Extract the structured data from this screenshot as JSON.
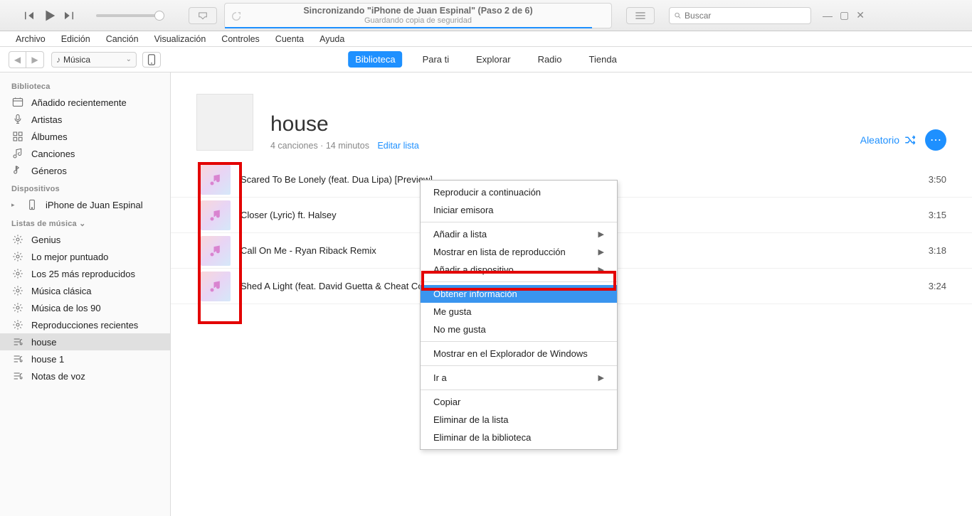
{
  "titlebar": {
    "sync_title": "Sincronizando \"iPhone de Juan Espinal\" (Paso 2 de 6)",
    "sync_sub": "Guardando copia de seguridad",
    "progress_pct": 95,
    "search_placeholder": "Buscar"
  },
  "menubar": [
    "Archivo",
    "Edición",
    "Canción",
    "Visualización",
    "Controles",
    "Cuenta",
    "Ayuda"
  ],
  "viewrow": {
    "source": "Música",
    "tabs": [
      "Biblioteca",
      "Para ti",
      "Explorar",
      "Radio",
      "Tienda"
    ],
    "active_tab": 0
  },
  "sidebar": {
    "h_library": "Biblioteca",
    "library": [
      {
        "icon": "recent",
        "label": "Añadido recientemente"
      },
      {
        "icon": "mic",
        "label": "Artistas"
      },
      {
        "icon": "album",
        "label": "Álbumes"
      },
      {
        "icon": "note",
        "label": "Canciones"
      },
      {
        "icon": "genre",
        "label": "Géneros"
      }
    ],
    "h_devices": "Dispositivos",
    "devices": [
      {
        "label": "iPhone de Juan Espinal"
      }
    ],
    "h_playlists": "Listas de música",
    "playlists": [
      {
        "icon": "gear",
        "label": "Genius"
      },
      {
        "icon": "gear",
        "label": "Lo mejor puntuado"
      },
      {
        "icon": "gear",
        "label": "Los 25 más reproducidos"
      },
      {
        "icon": "gear",
        "label": "Música clásica"
      },
      {
        "icon": "gear",
        "label": "Música de los 90"
      },
      {
        "icon": "gear",
        "label": "Reproducciones recientes"
      },
      {
        "icon": "pl",
        "label": "house",
        "selected": true
      },
      {
        "icon": "pl",
        "label": "house 1"
      },
      {
        "icon": "pl",
        "label": "Notas de voz"
      }
    ]
  },
  "playlist": {
    "title": "house",
    "sub": "4 canciones · 14 minutos",
    "edit": "Editar lista",
    "shuffle": "Aleatorio"
  },
  "songs": [
    {
      "title": "Scared To Be Lonely (feat. Dua Lipa) [Preview]",
      "dur": "3:50"
    },
    {
      "title": "Closer (Lyric) ft. Halsey",
      "dur": "3:15"
    },
    {
      "title": "Call On Me - Ryan Riback Remix",
      "dur": "3:18"
    },
    {
      "title": "Shed A Light (feat. David Guetta & Cheat Codes)",
      "dur": "3:24"
    }
  ],
  "ctx": {
    "items": [
      {
        "t": "Reproducir a continuación"
      },
      {
        "t": "Iniciar emisora"
      },
      {
        "sep": true
      },
      {
        "t": "Añadir a lista",
        "sub": true
      },
      {
        "t": "Mostrar en lista de reproducción",
        "sub": true
      },
      {
        "t": "Añadir a dispositivo",
        "sub": true
      },
      {
        "sep": true
      },
      {
        "t": "Obtener información",
        "hl": true
      },
      {
        "t": "Me gusta"
      },
      {
        "t": "No me gusta"
      },
      {
        "sep": true
      },
      {
        "t": "Mostrar en el Explorador de Windows"
      },
      {
        "sep": true
      },
      {
        "t": "Ir a",
        "sub": true
      },
      {
        "sep": true
      },
      {
        "t": "Copiar"
      },
      {
        "t": "Eliminar de la lista"
      },
      {
        "t": "Eliminar de la biblioteca"
      }
    ]
  }
}
